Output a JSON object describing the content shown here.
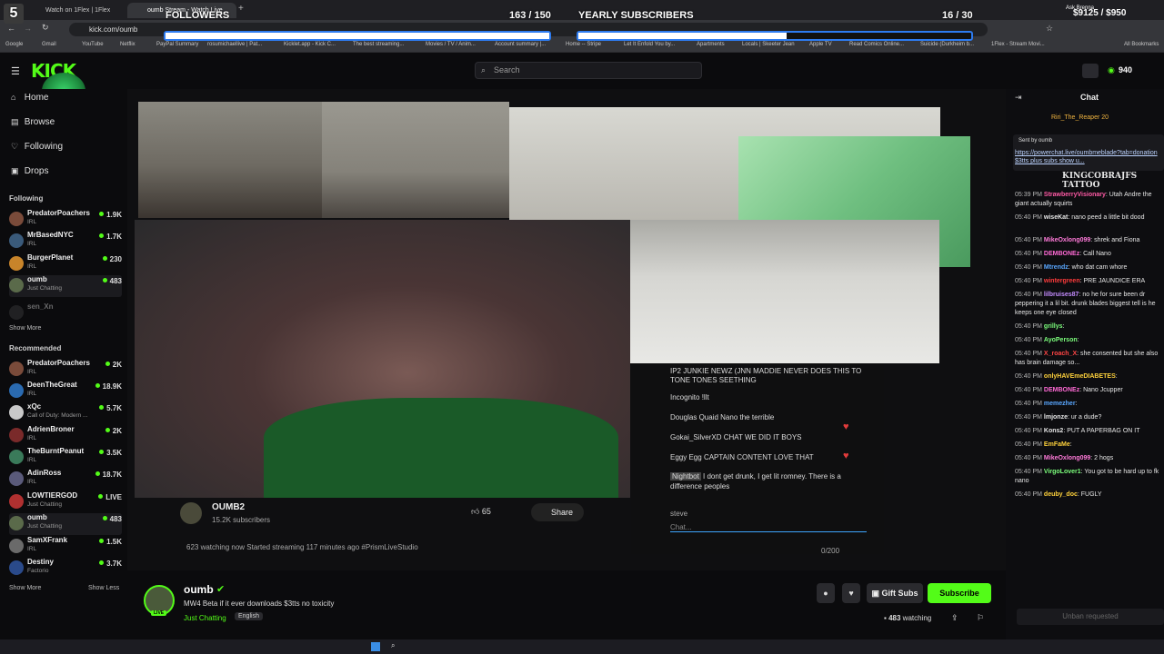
{
  "browser": {
    "tabs": [
      {
        "label": "Watch on 1Flex | 1Flex"
      },
      {
        "label": "oumb Stream - Watch Live"
      }
    ],
    "url": "kick.com/oumb",
    "bookmarks": [
      "Google",
      "Gmail",
      "YouTube",
      "Netflix",
      "PayPal Summary",
      "rosumichaellive | Pat...",
      "Kicklet.app - Kick C...",
      "The best streaming...",
      "Movies / TV / Anim...",
      "Account summary |...",
      "Home -- Stripe",
      "Let It Enfold You by...",
      "Apartments",
      "Locals | Skeeter Jean",
      "Apple TV",
      "Read Comics Online...",
      "Suicide (Durkheim b...",
      "1Flex - Stream Movi...",
      "All Bookmarks"
    ]
  },
  "overlay": {
    "badge": "5",
    "followers_label": "FOLLOWERS",
    "followers_value": "163 / 150",
    "followers_progress": 1.0,
    "subs_label": "YEARLY SUBSCRIBERS",
    "subs_value": "16 / 30",
    "subs_progress": 0.53,
    "money": "$9125 / $950",
    "ask": "Ask Brenna"
  },
  "kick": {
    "logo": "KICK",
    "search_placeholder": "Search",
    "points": "940",
    "nav": {
      "home": "Home",
      "browse": "Browse",
      "following": "Following",
      "drops": "Drops"
    },
    "following_label": "Following",
    "following": [
      {
        "name": "PredatorPoachers",
        "cat": "IRL",
        "viewers": "1.9K"
      },
      {
        "name": "MrBasedNYC",
        "cat": "IRL",
        "viewers": "1.7K"
      },
      {
        "name": "BurgerPlanet",
        "cat": "IRL",
        "viewers": "230"
      },
      {
        "name": "oumb",
        "cat": "Just Chatting",
        "viewers": "483"
      },
      {
        "name": "sen_Xn",
        "cat": "",
        "viewers": ""
      }
    ],
    "show_more": "Show More",
    "recommended_label": "Recommended",
    "recommended": [
      {
        "name": "PredatorPoachers",
        "cat": "IRL",
        "viewers": "2K"
      },
      {
        "name": "DeenTheGreat",
        "cat": "IRL",
        "viewers": "18.9K"
      },
      {
        "name": "xQc",
        "cat": "Call of Duty: Modern ...",
        "viewers": "5.7K"
      },
      {
        "name": "AdrienBroner",
        "cat": "IRL",
        "viewers": "2K"
      },
      {
        "name": "TheBurntPeanut",
        "cat": "IRL",
        "viewers": "3.5K"
      },
      {
        "name": "AdinRoss",
        "cat": "IRL",
        "viewers": "18.7K"
      },
      {
        "name": "LOWTIERGOD",
        "cat": "Just Chatting",
        "viewers": "LIVE"
      },
      {
        "name": "oumb",
        "cat": "Just Chatting",
        "viewers": "483"
      },
      {
        "name": "SamXFrank",
        "cat": "IRL",
        "viewers": "1.5K"
      },
      {
        "name": "Destiny",
        "cat": "Factorio",
        "viewers": "3.7K"
      }
    ],
    "show_more2": "Show More",
    "show_less": "Show Less"
  },
  "inner_yt": {
    "channel": "OUMB2",
    "subs": "15.2K subscribers",
    "likes": "65",
    "share": "Share",
    "watching": "623 watching now  Started streaming 117 minutes ago  #PrismLiveStudio",
    "chat": [
      {
        "user": "IP2 JUNKIE NEWZ (JNN",
        "msg": "MADDIE NEVER DOES THIS TO TONE TONES SEETHING"
      },
      {
        "user": "Incognito",
        "msg": "!llt"
      },
      {
        "user": "Douglas Quaid",
        "msg": "Nano the terrible"
      },
      {
        "user": "Gokai_SilverXD",
        "msg": "CHAT WE DID IT BOYS"
      },
      {
        "user": "Eggy Egg",
        "msg": "CAPTAIN CONTENT LOVE THAT"
      },
      {
        "user": "Nightbot",
        "msg": "I dont get drunk, I get lit romney. There is a difference peoples"
      }
    ],
    "input_user": "steve",
    "input_placeholder": "Chat...",
    "counter": "0/200"
  },
  "stream": {
    "name": "oumb",
    "title": "MW4 Beta if it ever downloads  $3tts no toxicity",
    "category": "Just Chatting",
    "language": "English",
    "viewers": "483",
    "watching_label": "watching",
    "gift_subs": "Gift Subs",
    "subscribe": "Subscribe",
    "live": "LIVE"
  },
  "chat": {
    "title": "Chat",
    "pinned_user": "Riri_The_Reaper",
    "pinned_count": "20",
    "sent_by": "Sent by",
    "sent_user": "oumb",
    "sent_link": "https://powerchat.live/oumbmeblade?tab=donation $3tts plus subs show u...",
    "banner": "KINGCOBRAJFS TATTOO",
    "messages": [
      {
        "time": "05:39 PM",
        "user": "StrawberryVisionary",
        "color": "#ff5aa5",
        "msg": "Utah Andre the giant actually squirts"
      },
      {
        "time": "05:40 PM",
        "user": "wiseKat",
        "color": "#e6e6e6",
        "msg": "nano peed a little bit dood"
      },
      {
        "time": "05:40 PM",
        "user": "MikeOxlong099",
        "color": "#ff7ad9",
        "msg": "shrek and Fiona"
      },
      {
        "time": "05:40 PM",
        "user": "DEMBONEz",
        "color": "#ff6ad5",
        "msg": "Call Nano"
      },
      {
        "time": "05:40 PM",
        "user": "Mtrendz",
        "color": "#59a7ff",
        "msg": "who dat cam whore"
      },
      {
        "time": "05:40 PM",
        "user": "wintergreen",
        "color": "#ff3b3b",
        "msg": "PRE JAUNDICE ERA"
      },
      {
        "time": "05:40 PM",
        "user": "lilbruises87",
        "color": "#c48cff",
        "msg": "no he for sure been dr peppering it a lil bit. drunk blades biggest tell is he keeps one eye closed"
      },
      {
        "time": "05:40 PM",
        "user": "grillys",
        "color": "#7cff7c",
        "msg": ""
      },
      {
        "time": "05:40 PM",
        "user": "AyoPerson",
        "color": "#7cff7c",
        "msg": ""
      },
      {
        "time": "05:40 PM",
        "user": "X_roach_X",
        "color": "#ff4545",
        "msg": "she consented but she also has brain damage so..."
      },
      {
        "time": "05:40 PM",
        "user": "onlyHAVEmeDIABETES",
        "color": "#ffd23c",
        "msg": ""
      },
      {
        "time": "05:40 PM",
        "user": "DEMBONEz",
        "color": "#ff6ad5",
        "msg": "Nano Jcupper"
      },
      {
        "time": "05:40 PM",
        "user": "memezher",
        "color": "#59a7ff",
        "msg": ""
      },
      {
        "time": "05:40 PM",
        "user": "lmjonze",
        "color": "#e6e6e6",
        "msg": "ur a dude?"
      },
      {
        "time": "05:40 PM",
        "user": "Kons2",
        "color": "#e6e6e6",
        "msg": "PUT A PAPERBAG ON IT"
      },
      {
        "time": "05:40 PM",
        "user": "EmFaMe",
        "color": "#ffd23c",
        "msg": ""
      },
      {
        "time": "05:40 PM",
        "user": "MikeOxlong099",
        "color": "#ff7ad9",
        "msg": "2 hogs"
      },
      {
        "time": "05:40 PM",
        "user": "VirgoLover1",
        "color": "#7cff7c",
        "msg": "You got to be hard up to fk nano"
      },
      {
        "time": "05:40 PM",
        "user": "deuby_doc",
        "color": "#ffd23c",
        "msg": "FUGLY"
      }
    ],
    "unban": "Unban requested"
  },
  "colors": {
    "kick_green": "#53fc18",
    "bg": "#0b0b0d"
  }
}
